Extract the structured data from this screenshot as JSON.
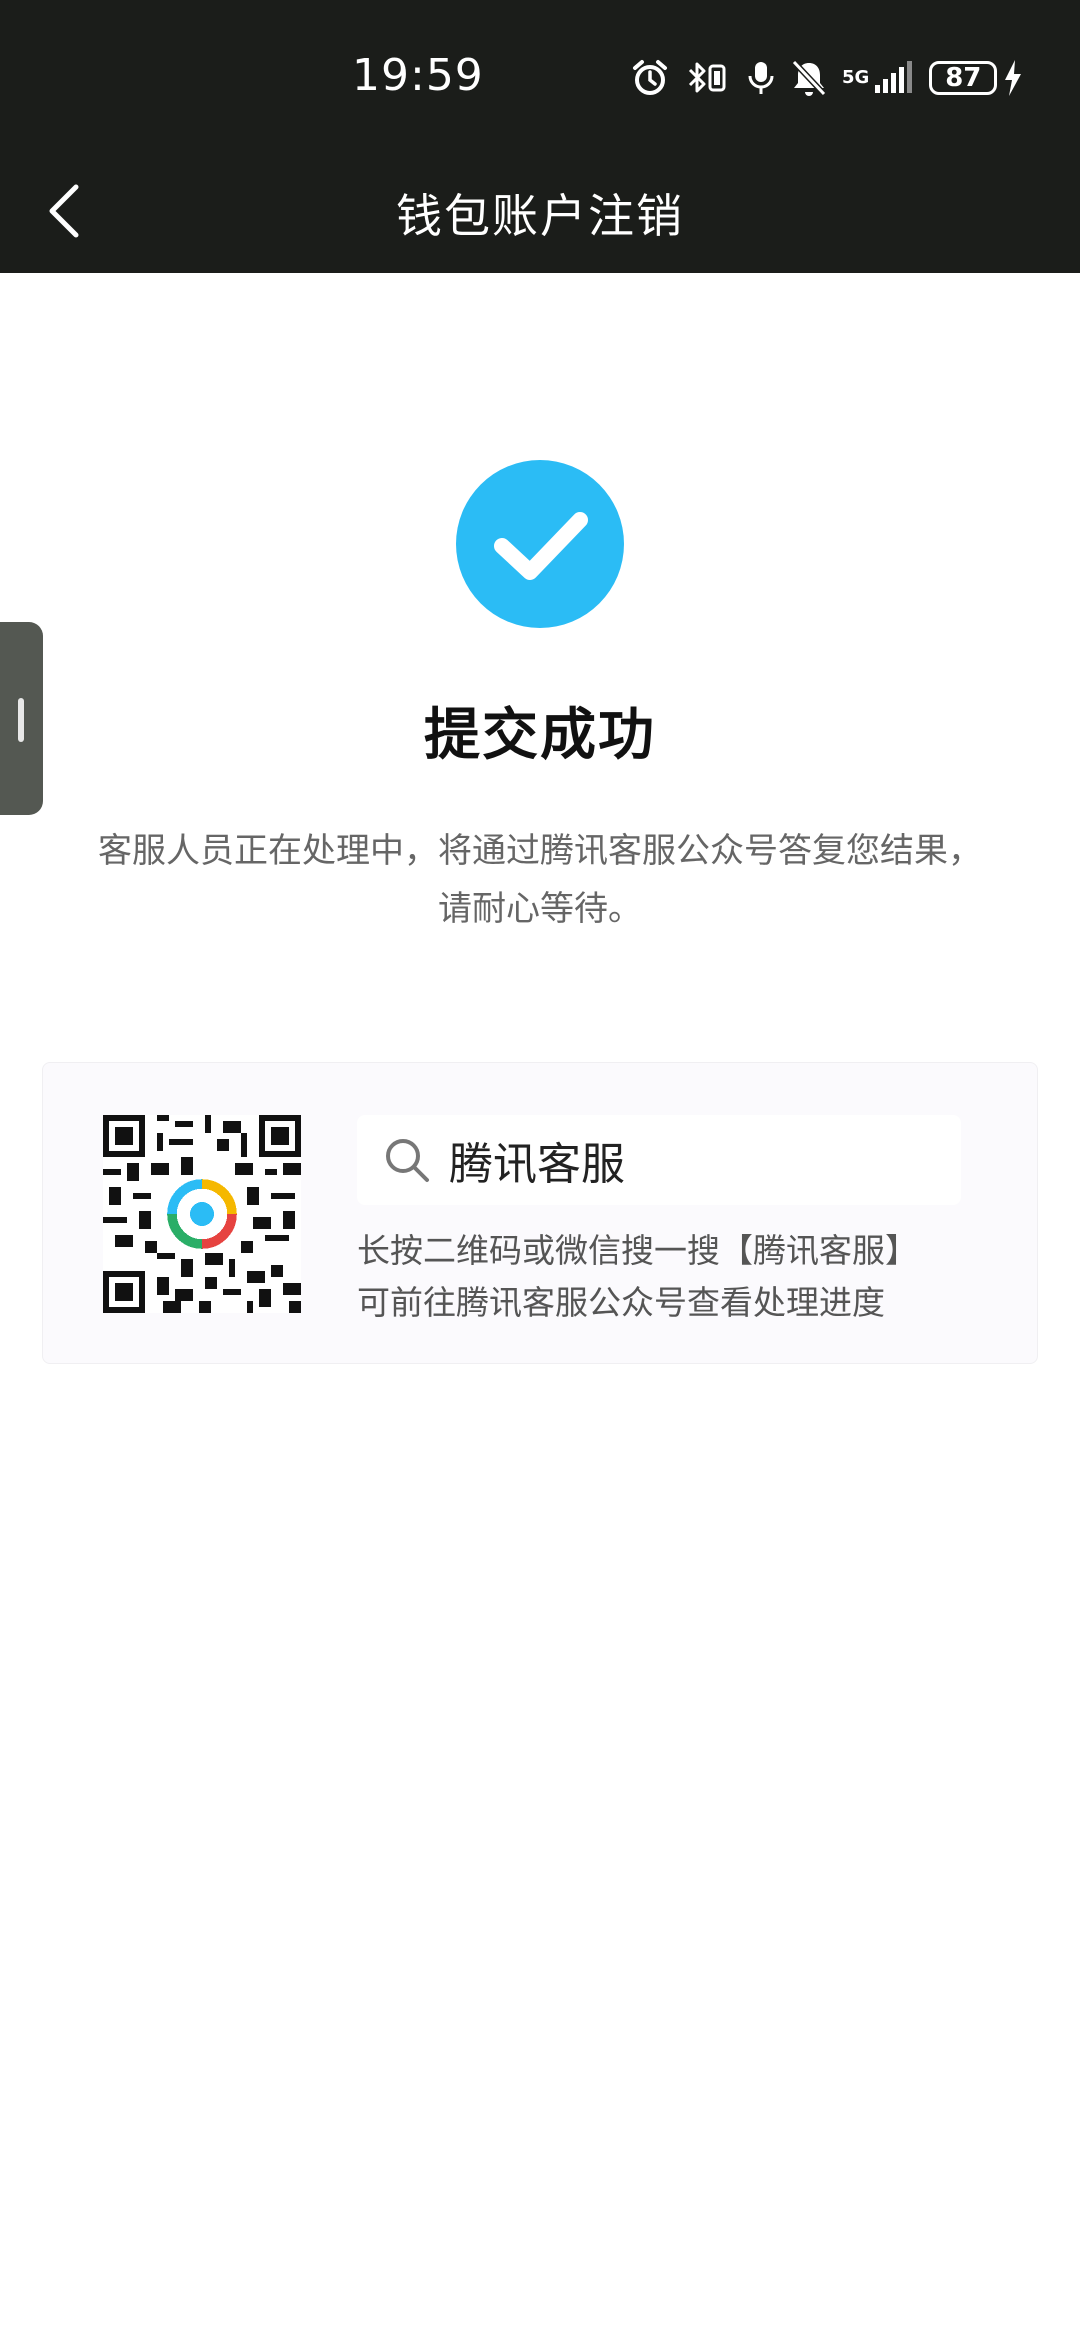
{
  "status_bar": {
    "time": "19:59",
    "network": "5G",
    "battery": "87"
  },
  "nav": {
    "title": "钱包账户注销"
  },
  "result": {
    "title": "提交成功",
    "message_line1": "客服人员正在处理中，将通过腾讯客服公众号答复您结果，",
    "message_line2": "请耐心等待。"
  },
  "card": {
    "search_text": "腾讯客服",
    "hint_line1": "长按二维码或微信搜一搜【腾讯客服】",
    "hint_line2": "可前往腾讯客服公众号查看处理进度"
  },
  "colors": {
    "header_bg": "#1b1d1a",
    "success_blue": "#2bbcf5"
  }
}
